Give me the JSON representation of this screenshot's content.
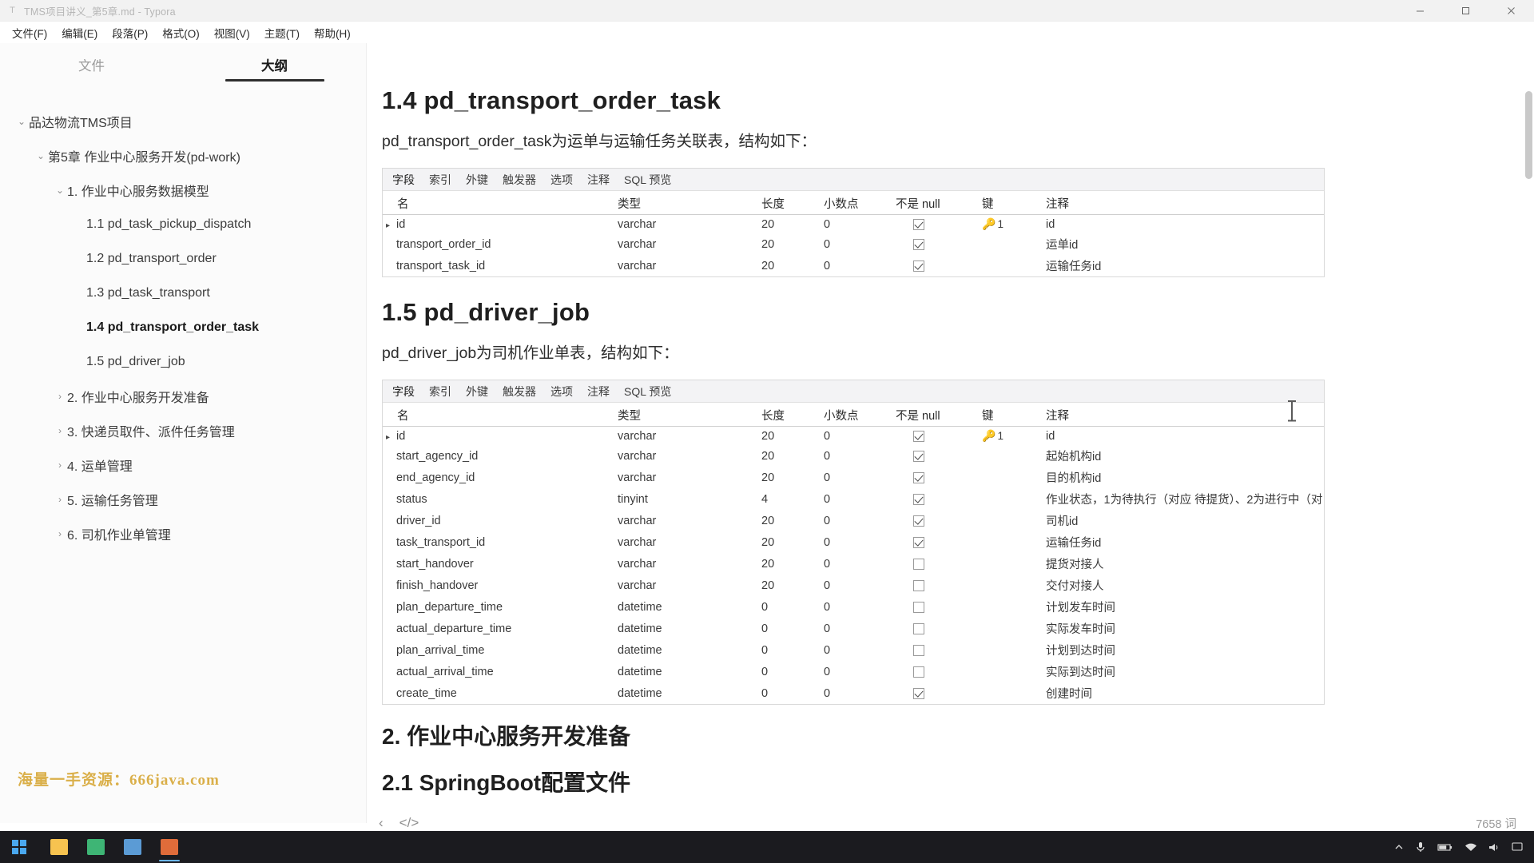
{
  "window": {
    "title": "TMS项目讲义_第5章.md - Typora",
    "app_icon": "typora-icon",
    "minimize": "–",
    "maximize": "□",
    "close": "✕"
  },
  "menubar": [
    {
      "label": "文件(F)"
    },
    {
      "label": "编辑(E)"
    },
    {
      "label": "段落(P)"
    },
    {
      "label": "格式(O)"
    },
    {
      "label": "视图(V)"
    },
    {
      "label": "主题(T)"
    },
    {
      "label": "帮助(H)"
    }
  ],
  "sidebar": {
    "tabs": [
      {
        "label": "文件",
        "active": false
      },
      {
        "label": "大纲",
        "active": true
      }
    ],
    "outline": [
      {
        "label": "品达物流TMS项目",
        "indent": 0,
        "caret": "⌄",
        "active": false
      },
      {
        "label": "第5章 作业中心服务开发(pd-work)",
        "indent": 1,
        "caret": "⌄",
        "active": false
      },
      {
        "label": "1. 作业中心服务数据模型",
        "indent": 2,
        "caret": "⌄",
        "active": false
      },
      {
        "label": "1.1 pd_task_pickup_dispatch",
        "indent": 3,
        "caret": "",
        "active": false
      },
      {
        "label": "1.2 pd_transport_order",
        "indent": 3,
        "caret": "",
        "active": false
      },
      {
        "label": "1.3 pd_task_transport",
        "indent": 3,
        "caret": "",
        "active": false
      },
      {
        "label": "1.4 pd_transport_order_task",
        "indent": 3,
        "caret": "",
        "active": true
      },
      {
        "label": "1.5 pd_driver_job",
        "indent": 3,
        "caret": "",
        "active": false
      },
      {
        "label": "2. 作业中心服务开发准备",
        "indent": 2,
        "caret": "›",
        "active": false
      },
      {
        "label": "3. 快递员取件、派件任务管理",
        "indent": 2,
        "caret": "›",
        "active": false
      },
      {
        "label": "4. 运单管理",
        "indent": 2,
        "caret": "›",
        "active": false
      },
      {
        "label": "5. 运输任务管理",
        "indent": 2,
        "caret": "›",
        "active": false
      },
      {
        "label": "6. 司机作业单管理",
        "indent": 2,
        "caret": "›",
        "active": false
      }
    ],
    "watermark": "海量一手资源：666java.com"
  },
  "document": {
    "heading_14": "1.4 pd_transport_order_task",
    "paragraph_14": "pd_transport_order_task为运单与运输任务关联表，结构如下：",
    "heading_15": "1.5 pd_driver_job",
    "paragraph_15": "pd_driver_job为司机作业单表，结构如下：",
    "heading_2": "2. 作业中心服务开发准备",
    "heading_21": "2.1 SpringBoot配置文件"
  },
  "navicat_tabs": [
    "字段",
    "索引",
    "外键",
    "触发器",
    "选项",
    "注释",
    "SQL 预览"
  ],
  "navicat_columns": [
    "名",
    "类型",
    "长度",
    "小数点",
    "不是 null",
    "键",
    "注释"
  ],
  "table_order_task": {
    "rows": [
      {
        "marker": "▸",
        "name": "id",
        "type": "varchar",
        "length": "20",
        "decimals": "0",
        "notnull": true,
        "key": "1",
        "comment": "id"
      },
      {
        "marker": "",
        "name": "transport_order_id",
        "type": "varchar",
        "length": "20",
        "decimals": "0",
        "notnull": true,
        "key": "",
        "comment": "运单id"
      },
      {
        "marker": "",
        "name": "transport_task_id",
        "type": "varchar",
        "length": "20",
        "decimals": "0",
        "notnull": true,
        "key": "",
        "comment": "运输任务id"
      }
    ]
  },
  "table_driver_job": {
    "rows": [
      {
        "marker": "▸",
        "name": "id",
        "type": "varchar",
        "length": "20",
        "decimals": "0",
        "notnull": true,
        "key": "1",
        "comment": "id"
      },
      {
        "marker": "",
        "name": "start_agency_id",
        "type": "varchar",
        "length": "20",
        "decimals": "0",
        "notnull": true,
        "key": "",
        "comment": "起始机构id"
      },
      {
        "marker": "",
        "name": "end_agency_id",
        "type": "varchar",
        "length": "20",
        "decimals": "0",
        "notnull": true,
        "key": "",
        "comment": "目的机构id"
      },
      {
        "marker": "",
        "name": "status",
        "type": "tinyint",
        "length": "4",
        "decimals": "0",
        "notnull": true,
        "key": "",
        "comment": "作业状态，1为待执行（对应 待提货）、2为进行中（对"
      },
      {
        "marker": "",
        "name": "driver_id",
        "type": "varchar",
        "length": "20",
        "decimals": "0",
        "notnull": true,
        "key": "",
        "comment": "司机id"
      },
      {
        "marker": "",
        "name": "task_transport_id",
        "type": "varchar",
        "length": "20",
        "decimals": "0",
        "notnull": true,
        "key": "",
        "comment": "运输任务id"
      },
      {
        "marker": "",
        "name": "start_handover",
        "type": "varchar",
        "length": "20",
        "decimals": "0",
        "notnull": false,
        "key": "",
        "comment": "提货对接人"
      },
      {
        "marker": "",
        "name": "finish_handover",
        "type": "varchar",
        "length": "20",
        "decimals": "0",
        "notnull": false,
        "key": "",
        "comment": "交付对接人"
      },
      {
        "marker": "",
        "name": "plan_departure_time",
        "type": "datetime",
        "length": "0",
        "decimals": "0",
        "notnull": false,
        "key": "",
        "comment": "计划发车时间"
      },
      {
        "marker": "",
        "name": "actual_departure_time",
        "type": "datetime",
        "length": "0",
        "decimals": "0",
        "notnull": false,
        "key": "",
        "comment": "实际发车时间"
      },
      {
        "marker": "",
        "name": "plan_arrival_time",
        "type": "datetime",
        "length": "0",
        "decimals": "0",
        "notnull": false,
        "key": "",
        "comment": "计划到达时间"
      },
      {
        "marker": "",
        "name": "actual_arrival_time",
        "type": "datetime",
        "length": "0",
        "decimals": "0",
        "notnull": false,
        "key": "",
        "comment": "实际到达时间"
      },
      {
        "marker": "",
        "name": "create_time",
        "type": "datetime",
        "length": "0",
        "decimals": "0",
        "notnull": true,
        "key": "",
        "comment": "创建时间"
      }
    ]
  },
  "editor_footer": {
    "prev_label": "‹",
    "source_label": "</>",
    "word_count": "7658 词"
  },
  "taskbar": {
    "start_label": "start-button",
    "apps": [
      {
        "name": "file-explorer",
        "color": "#f7c350",
        "active": false
      },
      {
        "name": "wechat",
        "color": "#3eb575",
        "active": false
      },
      {
        "name": "notepad",
        "color": "#5b9bd5",
        "active": false
      },
      {
        "name": "typora",
        "color": "#e06c3a",
        "active": true
      }
    ],
    "tray_icons": [
      "chevron-up-icon",
      "microphone-icon",
      "battery-icon",
      "network-icon",
      "volume-icon",
      "notification-icon"
    ]
  },
  "colors": {
    "accent": "#2f2f2f",
    "key_gold": "#d8a422",
    "watermark": "#d8a93a"
  }
}
